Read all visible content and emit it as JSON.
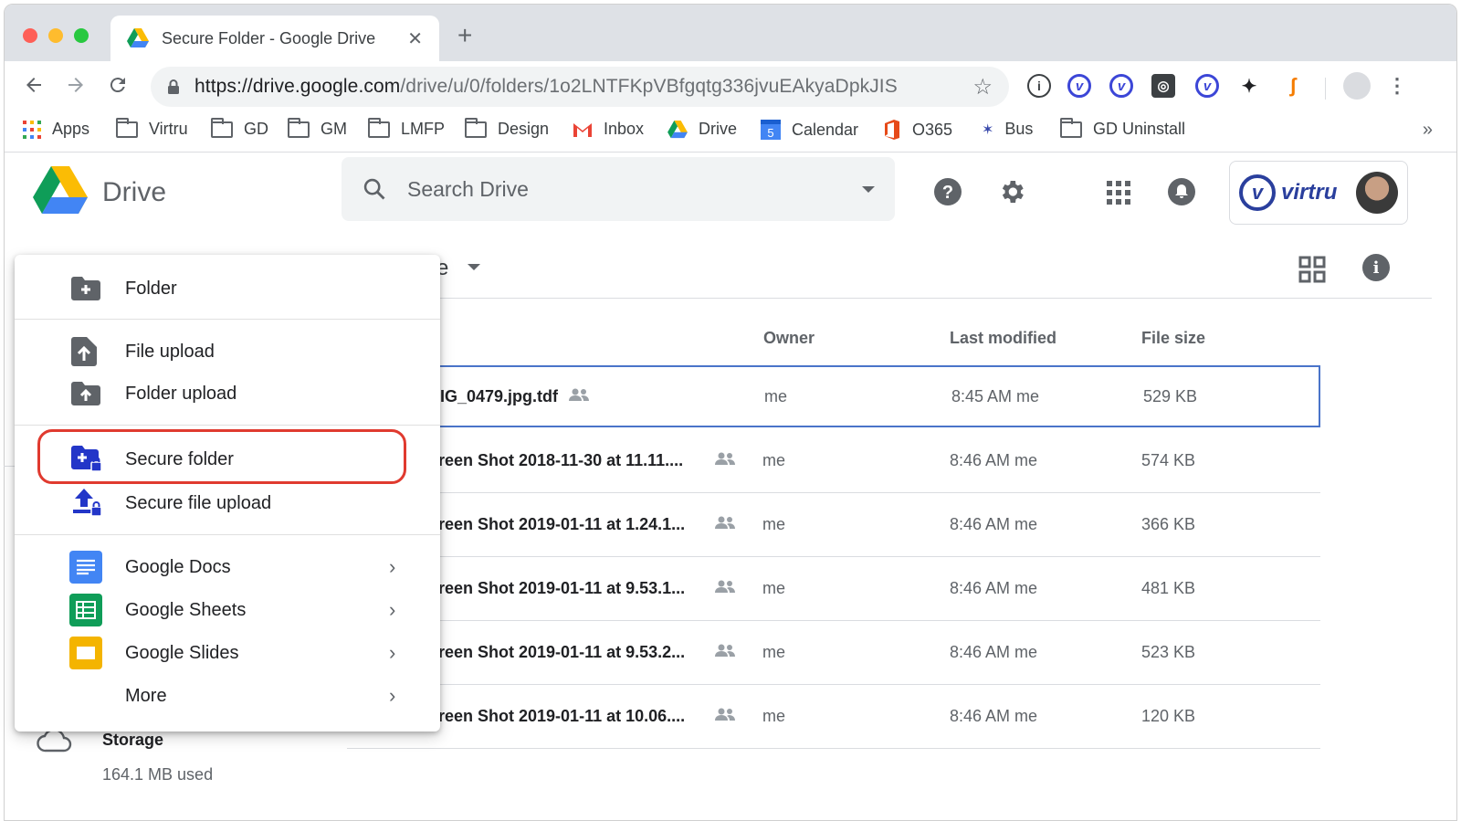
{
  "browser": {
    "tab_title": "Secure Folder - Google Drive",
    "tab_close": "✕",
    "new_tab": "+",
    "url_host": "https://drive.google.com",
    "url_path": "/drive/u/0/folders/1o2LNTFKpVBfgqtg336jvuEAkyaDpkJIS",
    "bookmarks": [
      "Apps",
      "Virtru",
      "GD",
      "GM",
      "LMFP",
      "Design",
      "Inbox",
      "Drive",
      "Calendar",
      "O365",
      "Bus",
      "GD Uninstall"
    ],
    "calendar_day": "5",
    "more_bookmarks": "»"
  },
  "drive": {
    "app_name": "Drive",
    "search_placeholder": "Search Drive",
    "account_brand": "virtru",
    "breadcrumb_tail": "e"
  },
  "table": {
    "columns": [
      "Owner",
      "Last modified",
      "File size"
    ],
    "rows": [
      {
        "name": "IG_0479.jpg.tdf",
        "owner": "me",
        "modified": "8:45 AM me",
        "size": "529 KB"
      },
      {
        "name": "reen Shot 2018-11-30 at 11.11....",
        "owner": "me",
        "modified": "8:46 AM me",
        "size": "574 KB"
      },
      {
        "name": "reen Shot 2019-01-11 at 1.24.1...",
        "owner": "me",
        "modified": "8:46 AM me",
        "size": "366 KB"
      },
      {
        "name": "reen Shot 2019-01-11 at 9.53.1...",
        "owner": "me",
        "modified": "8:46 AM me",
        "size": "481 KB"
      },
      {
        "name": "reen Shot 2019-01-11 at 9.53.2...",
        "owner": "me",
        "modified": "8:46 AM me",
        "size": "523 KB"
      },
      {
        "name": "reen Shot 2019-01-11 at 10.06....",
        "owner": "me",
        "modified": "8:46 AM me",
        "size": "120 KB"
      }
    ]
  },
  "storage": {
    "label": "Storage",
    "used": "164.1 MB used"
  },
  "new_menu": {
    "folder": "Folder",
    "file_upload": "File upload",
    "folder_upload": "Folder upload",
    "secure_folder": "Secure folder",
    "secure_file_upload": "Secure file upload",
    "google_docs": "Google Docs",
    "google_sheets": "Google Sheets",
    "google_slides": "Google Slides",
    "more": "More",
    "arrow": "›"
  },
  "colors": {
    "highlight_ring": "#e03a2f",
    "selected_row_border": "#4a74c9",
    "virtru_blue": "#2a3f9d",
    "docs_blue": "#4285f4",
    "sheets_green": "#0f9d58",
    "slides_yellow": "#f4b400"
  },
  "icons": [
    "back-arrow-icon",
    "forward-arrow-icon",
    "reload-icon",
    "lock-icon",
    "star-icon",
    "search-icon",
    "help-icon",
    "settings-gear-icon",
    "apps-grid-icon",
    "notifications-bell-icon",
    "grid-view-icon",
    "info-icon",
    "shared-people-icon",
    "cloud-icon",
    "new-folder-icon",
    "file-upload-icon",
    "folder-upload-icon",
    "secure-folder-icon",
    "secure-upload-icon"
  ]
}
